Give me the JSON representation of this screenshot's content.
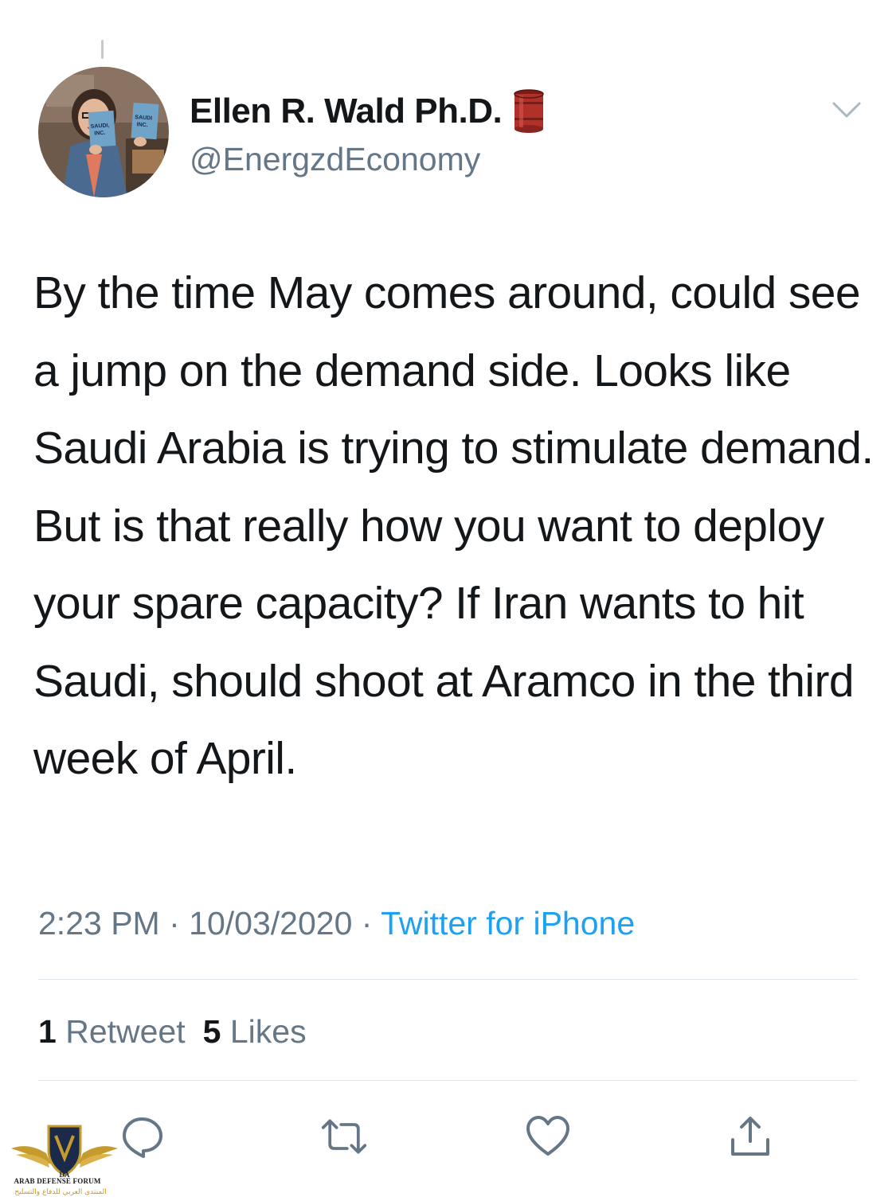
{
  "author": {
    "display_name": "Ellen R. Wald Ph.D.",
    "name_emoji": "oil-barrel-icon",
    "handle": "@EnergzdEconomy",
    "avatar": "profile-photo-holding-books",
    "avatar_book_title": "SAUDI, INC."
  },
  "header": {
    "menu_icon": "chevron-down-icon"
  },
  "tweet": {
    "text": "By the time May comes around, could see a jump on the demand side. Looks like Saudi Arabia is trying to stimulate demand. But is that really how you want to deploy your spare capacity? If Iran wants to hit Saudi, should shoot at Aramco in the third week of April."
  },
  "meta": {
    "time": "2:23 PM",
    "separator": "·",
    "date": "10/03/2020",
    "source": "Twitter for iPhone"
  },
  "stats": {
    "retweets_count": "1",
    "retweets_label": "Retweet",
    "likes_count": "5",
    "likes_label": "Likes"
  },
  "actions": [
    {
      "icon": "reply-icon"
    },
    {
      "icon": "retweet-icon"
    },
    {
      "icon": "like-heart-icon"
    },
    {
      "icon": "share-icon"
    }
  ],
  "watermark": {
    "logo_text": "DA",
    "english": "ARAB DEFENSE FORUM",
    "arabic": "المنتدى العربي للدفاع والتسليح"
  },
  "colors": {
    "text_primary": "#14171a",
    "text_secondary": "#657786",
    "link_blue": "#1da1f2",
    "divider": "#e1e8ed",
    "barrel_red": "#b0312a",
    "watermark_gold": "#c59b2e",
    "watermark_navy": "#1b2a4a"
  }
}
